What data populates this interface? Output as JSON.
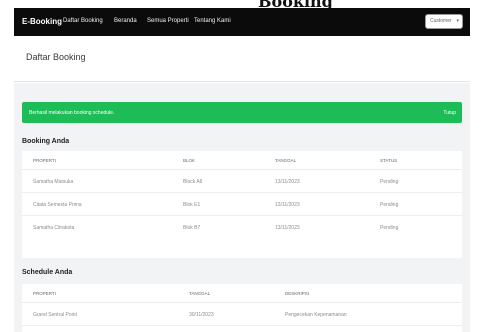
{
  "heading_fragment": "Booking",
  "navbar": {
    "brand": "E-Booking",
    "links": [
      "Daftar Booking",
      "Beranda",
      "Semua Properti",
      "Tentang Kami"
    ],
    "user_button": "Customer"
  },
  "page_title": "Daftar Booking",
  "alert": {
    "message": "Berhasil melakukan booking schedule.",
    "close_label": "Tutup"
  },
  "booking": {
    "title": "Booking Anda",
    "columns": [
      "PROPERTI",
      "BLOK",
      "TANGGAL",
      "STATUS"
    ],
    "rows": [
      [
        "Samatha Matsuka",
        "Block A6",
        "13/11/2023",
        "Pending"
      ],
      [
        "Citata Semesta Prima",
        "Blok E1",
        "13/11/2023",
        "Pending"
      ],
      [
        "Samatha Citrakota",
        "Blok B7",
        "13/11/2023",
        "Pending"
      ]
    ]
  },
  "schedule": {
    "title": "Schedule Anda",
    "columns": [
      "PROPERTI",
      "TANGGAL",
      "DESKRIPSI"
    ],
    "rows": [
      [
        "Grand Sentral Point",
        "30/11/2023",
        "Pengecekan Kepenamanan"
      ]
    ]
  }
}
